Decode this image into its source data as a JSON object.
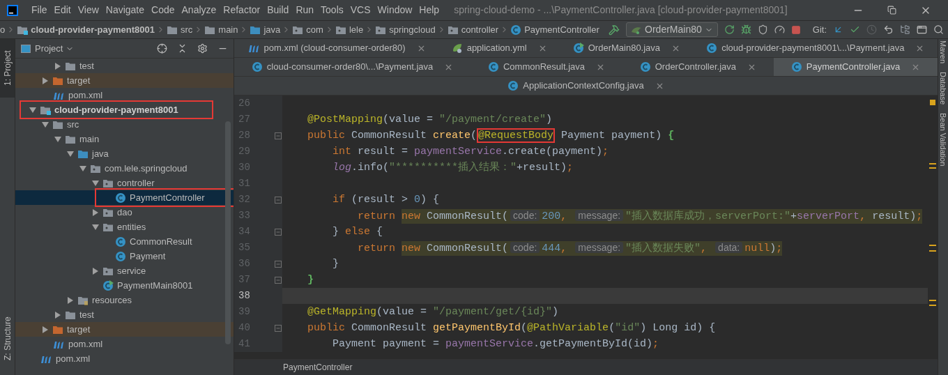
{
  "menu": [
    "File",
    "Edit",
    "View",
    "Navigate",
    "Code",
    "Analyze",
    "Refactor",
    "Build",
    "Run",
    "Tools",
    "VCS",
    "Window",
    "Help"
  ],
  "window": {
    "title": "spring-cloud-demo - ...\\PaymentController.java [cloud-provider-payment8001]"
  },
  "breadcrumbs": [
    {
      "label": "o",
      "kind": "text"
    },
    {
      "label": "cloud-provider-payment8001",
      "kind": "module"
    },
    {
      "label": "src",
      "kind": "folder"
    },
    {
      "label": "main",
      "kind": "folder"
    },
    {
      "label": "java",
      "kind": "source_root"
    },
    {
      "label": "com",
      "kind": "package"
    },
    {
      "label": "lele",
      "kind": "package"
    },
    {
      "label": "springcloud",
      "kind": "package"
    },
    {
      "label": "controller",
      "kind": "package"
    },
    {
      "label": "PaymentController",
      "kind": "class"
    }
  ],
  "run_config": "OrderMain80",
  "vcs_label": "Git:",
  "tool_strip": {
    "left_top": "1: Project",
    "left_bottom": "Z: Structure",
    "right": [
      "Maven",
      "Database",
      "Bean Validation"
    ]
  },
  "project_panel": {
    "title": "Project"
  },
  "tree": [
    {
      "kind": "hidden_parent",
      "children": [
        {
          "kind": "hidden_parent",
          "children": [
            {
              "label": "test",
              "kind": "folder",
              "expanded": false,
              "selected": false,
              "boxed": false
            }
          ]
        },
        {
          "label": "target",
          "kind": "excluded",
          "expanded": false,
          "selected": false,
          "boxed": false
        },
        {
          "label": "pom.xml",
          "kind": "maven",
          "selected": false,
          "boxed": false
        }
      ]
    },
    {
      "label": "cloud-provider-payment8001",
      "kind": "module",
      "expanded": true,
      "selected": false,
      "boxed": true,
      "children": [
        {
          "label": "src",
          "kind": "folder",
          "expanded": true,
          "selected": false,
          "boxed": false,
          "children": [
            {
              "label": "main",
              "kind": "folder",
              "expanded": true,
              "selected": false,
              "boxed": false,
              "children": [
                {
                  "label": "java",
                  "kind": "source_root",
                  "expanded": true,
                  "selected": false,
                  "boxed": false,
                  "children": [
                    {
                      "label": "com.lele.springcloud",
                      "kind": "package",
                      "expanded": true,
                      "selected": false,
                      "boxed": false,
                      "children": [
                        {
                          "label": "controller",
                          "kind": "package",
                          "expanded": true,
                          "selected": false,
                          "boxed": false,
                          "children": [
                            {
                              "label": "PaymentController",
                              "kind": "class",
                              "selected": true,
                              "boxed": true
                            }
                          ]
                        },
                        {
                          "label": "dao",
                          "kind": "package",
                          "expanded": false,
                          "selected": false,
                          "boxed": false
                        },
                        {
                          "label": "entities",
                          "kind": "package",
                          "expanded": true,
                          "selected": false,
                          "boxed": false,
                          "children": [
                            {
                              "label": "CommonResult",
                              "kind": "class",
                              "selected": false,
                              "boxed": false
                            },
                            {
                              "label": "Payment",
                              "kind": "class",
                              "selected": false,
                              "boxed": false
                            }
                          ]
                        },
                        {
                          "label": "service",
                          "kind": "package",
                          "expanded": false,
                          "selected": false,
                          "boxed": false
                        },
                        {
                          "label": "PaymentMain8001",
                          "kind": "spring_main",
                          "selected": false,
                          "boxed": false
                        }
                      ]
                    }
                  ]
                },
                {
                  "label": "resources",
                  "kind": "resources",
                  "expanded": false,
                  "selected": false,
                  "boxed": false
                }
              ]
            },
            {
              "label": "test",
              "kind": "folder",
              "expanded": false,
              "selected": false,
              "boxed": false
            }
          ]
        },
        {
          "label": "target",
          "kind": "excluded",
          "expanded": false,
          "selected": false,
          "boxed": false
        },
        {
          "label": "pom.xml",
          "kind": "maven",
          "selected": false,
          "boxed": false
        }
      ]
    },
    {
      "label": "pom.xml",
      "kind": "maven",
      "selected": false,
      "boxed": false
    }
  ],
  "tab_rows": [
    {
      "tabs": [
        {
          "label": "pom.xml (cloud-consumer-order80)",
          "kind": "maven",
          "selected": false
        },
        {
          "label": "application.yml",
          "kind": "yaml",
          "selected": false
        },
        {
          "label": "OrderMain80.java",
          "kind": "spring_main",
          "selected": false
        },
        {
          "label": "cloud-provider-payment8001\\...\\Payment.java",
          "kind": "class",
          "selected": false
        }
      ]
    },
    {
      "tabs": [
        {
          "label": "cloud-consumer-order80\\...\\Payment.java",
          "kind": "class",
          "selected": false
        },
        {
          "label": "CommonResult.java",
          "kind": "class",
          "selected": false
        },
        {
          "label": "OrderController.java",
          "kind": "class",
          "selected": false
        },
        {
          "label": "PaymentController.java",
          "kind": "class",
          "selected": true
        }
      ]
    },
    {
      "tabs": [
        {
          "label": "ApplicationContextConfig.java",
          "kind": "class",
          "selected": false
        }
      ]
    }
  ],
  "code_lines": [
    {
      "number": "26",
      "fold": false,
      "current": false
    },
    {
      "number": "27",
      "fold": false,
      "current": false,
      "segments": [
        {
          "marked": false,
          "tokens": [
            {
              "text": "    @PostMapping",
              "kind": "ann"
            },
            {
              "text": "(value = ",
              "kind": "plain"
            },
            {
              "text": "\"/payment/create\"",
              "kind": "str"
            },
            {
              "text": ")",
              "kind": "plain"
            }
          ]
        }
      ]
    },
    {
      "number": "28",
      "fold": true,
      "current": false,
      "segments": [
        {
          "marked": false,
          "tokens": [
            {
              "text": "    public",
              "kind": "kw"
            },
            {
              "text": " CommonResult ",
              "kind": "plain"
            },
            {
              "text": "create",
              "kind": "method"
            },
            {
              "text": "(",
              "kind": "plain"
            },
            {
              "text": "@RequestBody",
              "kind": "ann",
              "boxed": true
            },
            {
              "text": " Payment payment) ",
              "kind": "plain"
            },
            {
              "text": "{",
              "kind": "match"
            }
          ]
        }
      ]
    },
    {
      "number": "29",
      "fold": false,
      "current": false,
      "segments": [
        {
          "marked": false,
          "tokens": [
            {
              "text": "        int",
              "kind": "kw"
            },
            {
              "text": " result = ",
              "kind": "plain"
            },
            {
              "text": "paymentService",
              "kind": "field"
            },
            {
              "text": ".create(payment)",
              "kind": "plain"
            },
            {
              "text": ";",
              "kind": "kw"
            }
          ]
        }
      ]
    },
    {
      "number": "30",
      "fold": false,
      "current": false,
      "segments": [
        {
          "marked": false,
          "tokens": [
            {
              "text": "        log",
              "kind": "static"
            },
            {
              "text": ".info(",
              "kind": "plain"
            },
            {
              "text": "\"**********插入结果：\"",
              "kind": "str"
            },
            {
              "text": "+result)",
              "kind": "plain"
            },
            {
              "text": ";",
              "kind": "kw"
            }
          ]
        }
      ]
    },
    {
      "number": "31",
      "fold": false,
      "current": false
    },
    {
      "number": "32",
      "fold": true,
      "current": false,
      "segments": [
        {
          "marked": false,
          "tokens": [
            {
              "text": "        if",
              "kind": "kw"
            },
            {
              "text": " (result > ",
              "kind": "plain"
            },
            {
              "text": "0",
              "kind": "num"
            },
            {
              "text": ") {",
              "kind": "plain"
            }
          ]
        }
      ]
    },
    {
      "number": "33",
      "fold": false,
      "current": false,
      "segments": [
        {
          "marked": false,
          "tokens": [
            {
              "text": "            return ",
              "kind": "kw"
            }
          ]
        },
        {
          "marked": true,
          "tokens": [
            {
              "text": "new",
              "kind": "kw"
            },
            {
              "text": " CommonResult(",
              "kind": "plain"
            },
            {
              "text": "code:",
              "kind": "hint"
            },
            {
              "text": "200",
              "kind": "num"
            },
            {
              "text": ", ",
              "kind": "kw"
            },
            {
              "text": "message:",
              "kind": "hint"
            },
            {
              "text": "\"插入数据库成功，serverPort:\"",
              "kind": "str"
            },
            {
              "text": "+",
              "kind": "plain"
            },
            {
              "text": "serverPort",
              "kind": "field"
            },
            {
              "text": ", ",
              "kind": "kw"
            },
            {
              "text": "result)",
              "kind": "plain"
            },
            {
              "text": ";",
              "kind": "kw"
            }
          ]
        }
      ]
    },
    {
      "number": "34",
      "fold": true,
      "current": false,
      "segments": [
        {
          "marked": false,
          "tokens": [
            {
              "text": "        } ",
              "kind": "plain"
            },
            {
              "text": "else",
              "kind": "kw"
            },
            {
              "text": " {",
              "kind": "plain"
            }
          ]
        }
      ]
    },
    {
      "number": "35",
      "fold": false,
      "current": false,
      "segments": [
        {
          "marked": false,
          "tokens": [
            {
              "text": "            return ",
              "kind": "kw"
            }
          ]
        },
        {
          "marked": true,
          "tokens": [
            {
              "text": "new",
              "kind": "kw"
            },
            {
              "text": " CommonResult(",
              "kind": "plain"
            },
            {
              "text": "code:",
              "kind": "hint"
            },
            {
              "text": "444",
              "kind": "num"
            },
            {
              "text": ", ",
              "kind": "kw"
            },
            {
              "text": "message:",
              "kind": "hint"
            },
            {
              "text": "\"插入数据失败\"",
              "kind": "str"
            },
            {
              "text": ", ",
              "kind": "kw"
            },
            {
              "text": "data:",
              "kind": "hint"
            },
            {
              "text": "null",
              "kind": "kw"
            },
            {
              "text": ")",
              "kind": "plain"
            },
            {
              "text": ";",
              "kind": "kw"
            }
          ]
        }
      ]
    },
    {
      "number": "36",
      "fold": true,
      "current": false,
      "segments": [
        {
          "marked": false,
          "tokens": [
            {
              "text": "        }",
              "kind": "plain"
            }
          ]
        }
      ]
    },
    {
      "number": "37",
      "fold": true,
      "current": false,
      "segments": [
        {
          "marked": false,
          "tokens": [
            {
              "text": "    }",
              "kind": "match"
            }
          ]
        }
      ]
    },
    {
      "number": "38",
      "fold": false,
      "current": true
    },
    {
      "number": "39",
      "fold": false,
      "current": false,
      "segments": [
        {
          "marked": false,
          "tokens": [
            {
              "text": "    @GetMapping",
              "kind": "ann"
            },
            {
              "text": "(value = ",
              "kind": "plain"
            },
            {
              "text": "\"/payment/get/{id}\"",
              "kind": "str"
            },
            {
              "text": ")",
              "kind": "plain"
            }
          ]
        }
      ]
    },
    {
      "number": "40",
      "fold": true,
      "current": false,
      "segments": [
        {
          "marked": false,
          "tokens": [
            {
              "text": "    public",
              "kind": "kw"
            },
            {
              "text": " CommonResult ",
              "kind": "plain"
            },
            {
              "text": "getPaymentById",
              "kind": "method"
            },
            {
              "text": "(",
              "kind": "plain"
            },
            {
              "text": "@PathVariable",
              "kind": "ann"
            },
            {
              "text": "(",
              "kind": "plain"
            },
            {
              "text": "\"id\"",
              "kind": "str"
            },
            {
              "text": ") Long id) {",
              "kind": "plain"
            }
          ]
        }
      ]
    },
    {
      "number": "41",
      "fold": false,
      "current": false,
      "segments": [
        {
          "marked": false,
          "tokens": [
            {
              "text": "        Payment payment = ",
              "kind": "plain"
            },
            {
              "text": "paymentService",
              "kind": "field"
            },
            {
              "text": ".getPaymentById(id)",
              "kind": "plain"
            },
            {
              "text": ";",
              "kind": "kw"
            }
          ]
        }
      ]
    }
  ],
  "editor_breadcrumb": "PaymentController"
}
